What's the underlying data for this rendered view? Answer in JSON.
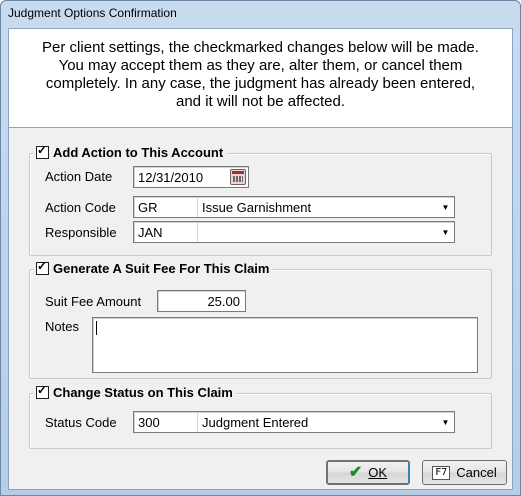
{
  "window": {
    "title": "Judgment Options Confirmation"
  },
  "header": {
    "lines": [
      "Per client settings, the checkmarked changes below will be made.",
      "You may accept them as they are, alter them, or cancel them",
      "completely.  In any case, the judgment has already been entered,",
      "and it will not be affected."
    ]
  },
  "add_action": {
    "checked": true,
    "legend": "Add Action to This Account",
    "action_date_label": "Action Date",
    "action_date_value": "12/31/2010",
    "action_code_label": "Action Code",
    "action_code_value": "GR",
    "action_code_desc": "Issue Garnishment",
    "responsible_label": "Responsible",
    "responsible_value": "JAN"
  },
  "suit_fee": {
    "checked": true,
    "legend": "Generate A Suit Fee For This Claim",
    "amount_label": "Suit Fee Amount",
    "amount_value": "25.00",
    "notes_label": "Notes",
    "notes_value": ""
  },
  "change_status": {
    "checked": true,
    "legend": "Change Status on This Claim",
    "status_code_label": "Status Code",
    "status_code_value": "300",
    "status_desc": "Judgment Entered"
  },
  "buttons": {
    "ok": "OK",
    "cancel": "Cancel",
    "cancel_key": "F7"
  }
}
